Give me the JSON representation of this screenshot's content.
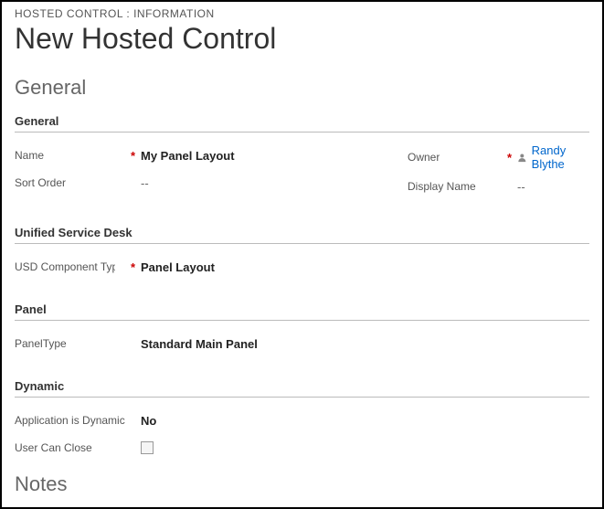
{
  "breadcrumb": "HOSTED CONTROL : INFORMATION",
  "pageTitle": "New Hosted Control",
  "sections": {
    "general": {
      "title": "General",
      "sub": "General",
      "fields": {
        "nameLabel": "Name",
        "nameValue": "My Panel Layout",
        "sortOrderLabel": "Sort Order",
        "sortOrderValue": "--",
        "ownerLabel": "Owner",
        "ownerValue": "Randy Blythe",
        "displayNameLabel": "Display Name",
        "displayNameValue": "--"
      }
    },
    "usd": {
      "sub": "Unified Service Desk",
      "componentLabel": "USD Component Type",
      "componentValue": "Panel Layout"
    },
    "panel": {
      "sub": "Panel",
      "panelTypeLabel": "PanelType",
      "panelTypeValue": "Standard Main Panel"
    },
    "dynamic": {
      "sub": "Dynamic",
      "appDynamicLabel": "Application is Dynamic",
      "appDynamicValue": "No",
      "userCanCloseLabel": "User Can Close"
    },
    "notes": {
      "title": "Notes"
    }
  },
  "requiredMark": "*"
}
